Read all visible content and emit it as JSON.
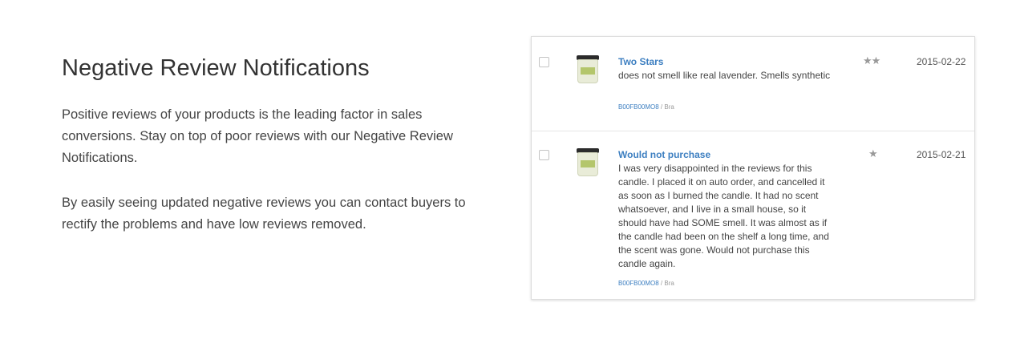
{
  "feature": {
    "title": "Negative Review Notifications",
    "paragraphs": [
      "Positive reviews of your products is the leading factor in sales conversions. Stay on top of poor reviews with our Negative Review Notifications.",
      "By easily seeing updated negative reviews you can contact buyers to rectify the problems and have low reviews removed."
    ]
  },
  "reviews": [
    {
      "title": "Two Stars",
      "body": "does not smell like real lavender. Smells synthetic",
      "asin": "B00FB00MO8",
      "extra": " / Bra",
      "stars": "★★",
      "rating": 2,
      "date": "2015-02-22",
      "product_icon": "candle-jar-icon"
    },
    {
      "title": "Would not purchase",
      "body": "I was very disappointed in the reviews for this candle. I placed it on auto order, and cancelled it as soon as I burned the candle. It had no scent whatsoever, and I live in a small house, so it should have had SOME smell. It was almost as if the candle had been on the shelf a long time, and the scent was gone. Would not purchase this candle again.",
      "asin": "B00FB00MO8",
      "extra": " / Bra",
      "stars": "★",
      "rating": 1,
      "date": "2015-02-21",
      "product_icon": "candle-jar-icon"
    }
  ],
  "colors": {
    "link": "#3d7fc1",
    "star": "#999999"
  }
}
